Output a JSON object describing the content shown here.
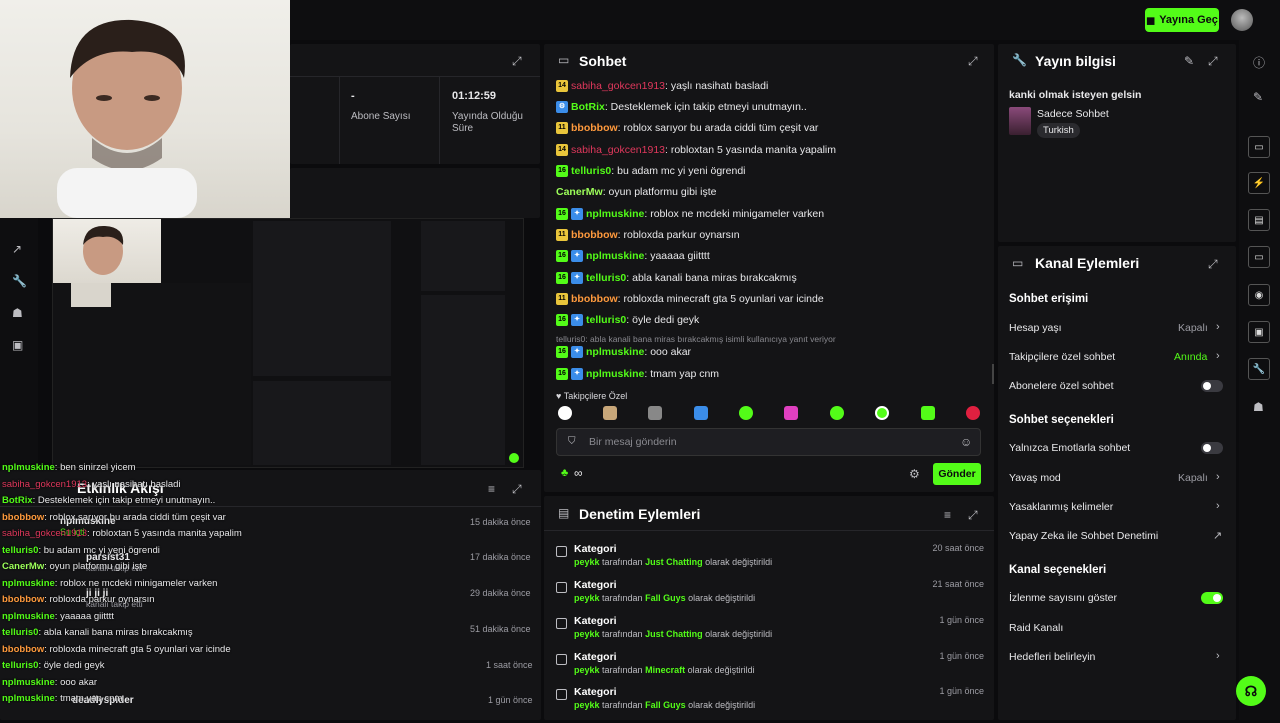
{
  "topbar": {
    "go_live": "Yayına Geç"
  },
  "stats": {
    "sub_value": "-",
    "sub_label": "Abone Sayısı",
    "live_value": "01:12:59",
    "live_label": "Yayında Olduğu Süre"
  },
  "activity": {
    "title": "Etkinlik Akışı",
    "items": [
      {
        "user": "nplmuskine",
        "text": "Su içti",
        "time": "15 dakika önce"
      },
      {
        "user": "parsist31",
        "text": "kanalı takip etti",
        "time": "17 dakika önce"
      },
      {
        "user": "ji ji ji",
        "text": "kanalı takip etti",
        "time": "29 dakika önce"
      },
      {
        "user": "",
        "text": "",
        "time": "51 dakika önce"
      },
      {
        "user": "",
        "text": "",
        "time": "1 saat önce"
      },
      {
        "user": "deadlyspider",
        "text": "",
        "time": "1 gün önce"
      }
    ],
    "overlay_chat": [
      {
        "user": "nplmuskine",
        "text": ": ben sinirzel yicem"
      },
      {
        "user": "sabiha_gokcen1913",
        "text": ": yaşlı nasihatı basladi"
      },
      {
        "user": "BotRix",
        "text": ": Desteklemek için takip etmeyi unutmayın.."
      },
      {
        "user": "bbobbow",
        "text": ": roblox sarıyor bu arada ciddi tüm çeşit var"
      },
      {
        "user": "sabiha_gokcen1913",
        "text": ": robloxtan 5 yasında manita yapalim"
      },
      {
        "user": "telluris0",
        "text": ": bu adam mc yi yeni ögrendi"
      },
      {
        "user": "CanerMw",
        "text": ": oyun platformu gibi işte"
      },
      {
        "user": "nplmuskine",
        "text": ": roblox ne mcdeki minigameler varken"
      },
      {
        "user": "bbobbow",
        "text": ": robloxda parkur oynarsın"
      },
      {
        "user": "nplmuskine",
        "text": ": yaaaaa giitttt"
      },
      {
        "user": "telluris0",
        "text": ": abla kanali bana miras bırakcakmış"
      },
      {
        "user": "bbobbow",
        "text": ": robloxda minecraft gta 5 oyunlari var icinde"
      },
      {
        "user": "telluris0",
        "text": ": öyle dedi geyk"
      },
      {
        "user": "nplmuskine",
        "text": ": ooo akar"
      },
      {
        "user": "nplmuskine",
        "text": ": tmam yap cnm"
      }
    ]
  },
  "chat": {
    "title": "Sohbet",
    "messages": [
      {
        "badge": "14",
        "user": "sabiha_gokcen1913",
        "text": ": yaşlı nasihatı basladi"
      },
      {
        "badge": "bot",
        "user": "BotRix",
        "text": ": Desteklemek için takip etmeyi unutmayın.."
      },
      {
        "badge": "11",
        "user": "bbobbow",
        "text": ": roblox sarıyor bu arada ciddi tüm çeşit var"
      },
      {
        "badge": "14",
        "user": "sabiha_gokcen1913",
        "text": ": robloxtan 5 yasında manita yapalim"
      },
      {
        "badge": "16",
        "user": "telluris0",
        "text": ": bu adam mc yi yeni ögrendi"
      },
      {
        "badge": "",
        "user": "CanerMw",
        "text": ": oyun platformu gibi işte"
      },
      {
        "badge": "16",
        "user": "nplmuskine",
        "text": ": roblox ne mcdeki minigameler varken"
      },
      {
        "badge": "11",
        "user": "bbobbow",
        "text": ": robloxda parkur oynarsın"
      },
      {
        "badge": "16",
        "user": "nplmuskine",
        "text": ": yaaaaa giitttt"
      },
      {
        "badge": "16",
        "user": "telluris0",
        "text": ": abla kanali bana miras bırakcakmış"
      },
      {
        "badge": "11",
        "user": "bbobbow",
        "text": ": robloxda minecraft gta 5 oyunlari var icinde"
      },
      {
        "badge": "16",
        "user": "telluris0",
        "text": ": öyle dedi geyk"
      },
      {
        "badge": "16",
        "user": "nplmuskine",
        "text": ": ooo akar"
      },
      {
        "badge": "16",
        "user": "nplmuskine",
        "text": ": tmam yap cnm"
      }
    ],
    "reply_hint": "telluris0: abla kanali bana miras bırakcakmış isimli kullanıcıya yanıt veriyor",
    "followers_only": "Takipçilere Özel",
    "input_placeholder": "Bir mesaj gönderin",
    "send": "Gönder"
  },
  "stream_info": {
    "title": "Yayın bilgisi",
    "stream_title": "kanki olmak isteyen gelsin",
    "category": "Sadece Sohbet",
    "language": "Turkish"
  },
  "channel_actions": {
    "title": "Kanal Eylemleri",
    "chat_access": "Sohbet erişimi",
    "account_age": "Hesap yaşı",
    "account_age_val": "Kapalı",
    "followers_chat": "Takipçilere özel sohbet",
    "followers_chat_val": "Anında",
    "subs_chat": "Abonelere özel sohbet",
    "chat_options": "Sohbet seçenekleri",
    "emote_only": "Yalnızca Emotlarla sohbet",
    "slow_mode": "Yavaş mod",
    "slow_mode_val": "Kapalı",
    "banned_words": "Yasaklanmış kelimeler",
    "ai_moderation": "Yapay Zeka ile Sohbet Denetimi",
    "channel_options": "Kanal seçenekleri",
    "show_viewers": "İzlenme sayısını göster",
    "raid": "Raid Kanalı",
    "goals": "Hedefleri belirleyin"
  },
  "mod_actions": {
    "title": "Denetim Eylemleri",
    "items": [
      {
        "title": "Kategori",
        "by": "peykk",
        "mid": " tarafından ",
        "cat": "Just Chatting",
        "end": " olarak değiştirildi",
        "time": "20 saat önce"
      },
      {
        "title": "Kategori",
        "by": "peykk",
        "mid": " tarafından ",
        "cat": "Fall Guys",
        "end": " olarak değiştirildi",
        "time": "21 saat önce"
      },
      {
        "title": "Kategori",
        "by": "peykk",
        "mid": " tarafından ",
        "cat": "Just Chatting",
        "end": " olarak değiştirildi",
        "time": "1 gün önce"
      },
      {
        "title": "Kategori",
        "by": "peykk",
        "mid": " tarafından ",
        "cat": "Minecraft",
        "end": " olarak değiştirildi",
        "time": "1 gün önce"
      },
      {
        "title": "Kategori",
        "by": "peykk",
        "mid": " tarafından ",
        "cat": "Fall Guys",
        "end": " olarak değiştirildi",
        "time": "1 gün önce"
      }
    ]
  },
  "colors": {
    "accent": "#53fc18",
    "bg": "#0b0b0d",
    "panel": "#141416"
  }
}
